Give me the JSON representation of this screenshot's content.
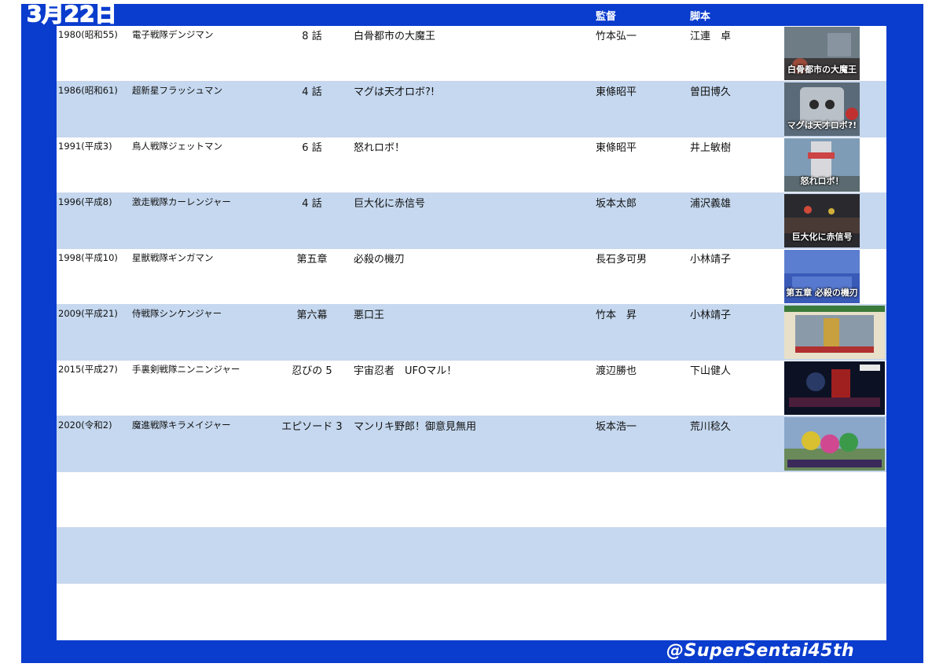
{
  "header": {
    "date": "3月22日",
    "director_label": "監督",
    "writer_label": "脚本"
  },
  "rows": [
    {
      "year": "1980(昭和55)",
      "series": "電子戦隊デンジマン",
      "episode": "8 話",
      "title": "白骨都市の大魔王",
      "director": "竹本弘一",
      "writer": "江連　卓",
      "thumb_caption": "白骨都市の大魔王"
    },
    {
      "year": "1986(昭和61)",
      "series": "超新星フラッシュマン",
      "episode": "4 話",
      "title": "マグは天才ロボ?!",
      "director": "東條昭平",
      "writer": "曽田博久",
      "thumb_caption": "マグは天才ロボ?!"
    },
    {
      "year": "1991(平成3)",
      "series": "鳥人戦隊ジェットマン",
      "episode": "6 話",
      "title": "怒れロボ！",
      "director": "東條昭平",
      "writer": "井上敏樹",
      "thumb_caption": "怒れロボ！"
    },
    {
      "year": "1996(平成8)",
      "series": "激走戦隊カーレンジャー",
      "episode": "4 話",
      "title": "巨大化に赤信号",
      "director": "坂本太郎",
      "writer": "浦沢義雄",
      "thumb_caption": "巨大化に赤信号"
    },
    {
      "year": "1998(平成10)",
      "series": "星獣戦隊ギンガマン",
      "episode": "第五章",
      "title": "必殺の機刃",
      "director": "長石多可男",
      "writer": "小林靖子",
      "thumb_caption": "第五章 必殺の機刃"
    },
    {
      "year": "2009(平成21)",
      "series": "侍戦隊シンケンジャー",
      "episode": "第六幕",
      "title": "悪口王",
      "director": "竹本　昇",
      "writer": "小林靖子",
      "thumb_caption": ""
    },
    {
      "year": "2015(平成27)",
      "series": "手裏剣戦隊ニンニンジャー",
      "episode": "忍びの 5",
      "title": "宇宙忍者　UFOマル！",
      "director": "渡辺勝也",
      "writer": "下山健人",
      "thumb_caption": ""
    },
    {
      "year": "2020(令和2)",
      "series": "魔進戦隊キラメイジャー",
      "episode": "エピソード 3",
      "title": "マンリキ野郎！御意見無用",
      "director": "坂本浩一",
      "writer": "荒川稔久",
      "thumb_caption": ""
    }
  ],
  "footer": {
    "handle": "@SuperSentai45th"
  },
  "colors": {
    "frame": "#0a3ccd",
    "stripe": "#c5d8ef"
  }
}
